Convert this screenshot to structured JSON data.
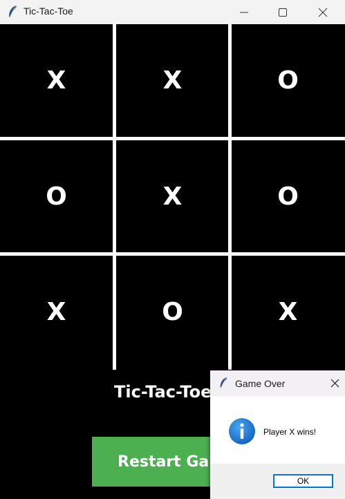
{
  "window": {
    "title": "Tic-Tac-Toe"
  },
  "board": {
    "cells": [
      "X",
      "X",
      "O",
      "O",
      "X",
      "O",
      "X",
      "O",
      "X"
    ]
  },
  "status": {
    "text": "Tic-Tac-Toe"
  },
  "restart": {
    "label": "Restart Game"
  },
  "dialog": {
    "title": "Game Over",
    "message": "Player X wins!",
    "ok_label": "OK"
  },
  "colors": {
    "board_bg": "#000000",
    "grid_lines": "#ffffff",
    "restart_bg": "#4caf50",
    "info_icon": "#1e88e5",
    "ok_border": "#0078d4"
  },
  "icons": [
    "feather-icon",
    "minimize-icon",
    "maximize-icon",
    "close-icon",
    "info-icon"
  ]
}
